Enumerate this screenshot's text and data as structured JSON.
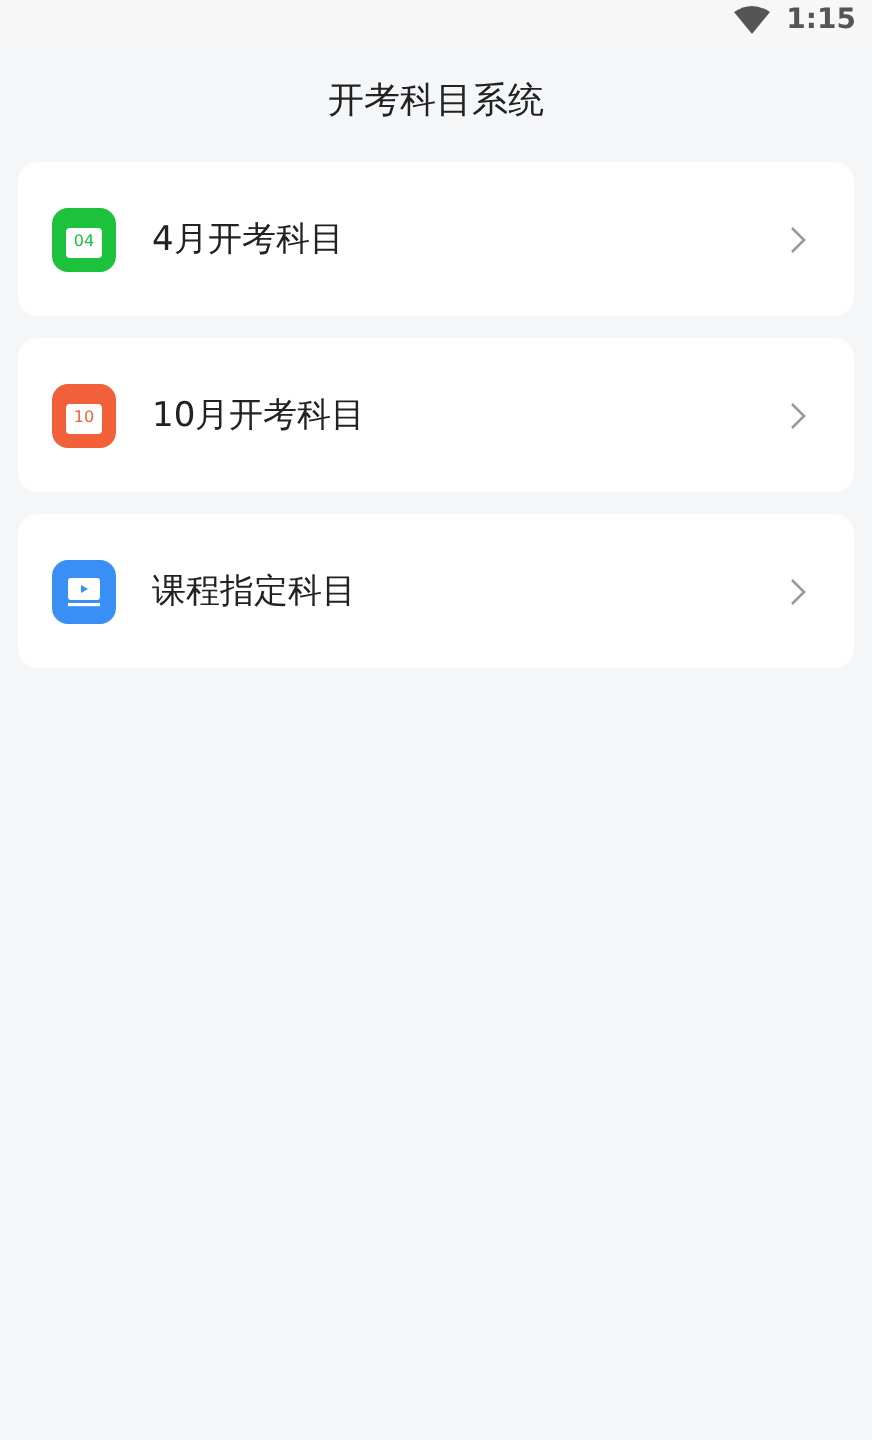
{
  "status_bar": {
    "time": "1:15"
  },
  "title": "开考科目系统",
  "items": [
    {
      "label": "4月开考科目",
      "kind": "calendar",
      "icon_text": "04",
      "color": "#1cc23c"
    },
    {
      "label": "10月开考科目",
      "kind": "calendar",
      "icon_text": "10",
      "color": "#f2603a"
    },
    {
      "label": "课程指定科目",
      "kind": "video",
      "color": "#3a8ff5"
    }
  ]
}
